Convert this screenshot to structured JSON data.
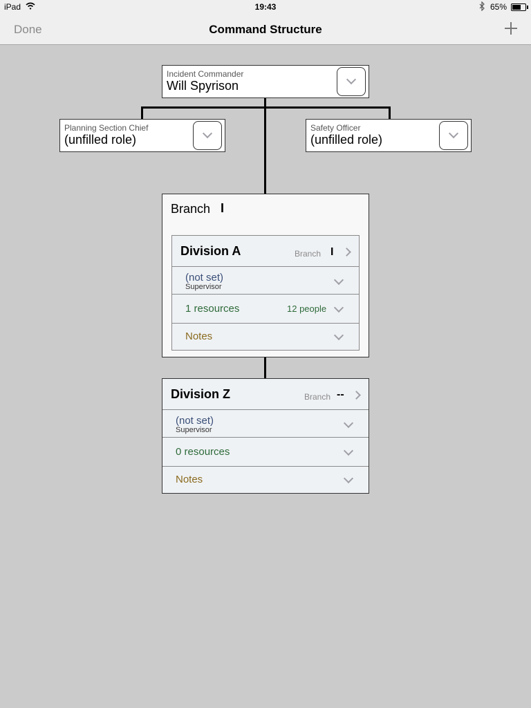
{
  "status_bar": {
    "device": "iPad",
    "time": "19:43",
    "battery": "65%"
  },
  "nav": {
    "done_label": "Done",
    "title": "Command Structure",
    "add_icon": "plus-icon"
  },
  "incident_commander": {
    "title": "Incident Commander",
    "name": "Will Spyrison"
  },
  "planning_chief": {
    "title": "Planning Section Chief",
    "name": "(unfilled role)"
  },
  "safety_officer": {
    "title": "Safety Officer",
    "name": "(unfilled role)"
  },
  "branch": {
    "label": "Branch",
    "number": "I"
  },
  "divisions": [
    {
      "name": "Division A",
      "branch_label": "Branch",
      "branch_value": "I",
      "supervisor_value": "(not set)",
      "supervisor_label": "Supervisor",
      "resources": "1 resources",
      "people": "12 people",
      "notes": "Notes"
    },
    {
      "name": "Division Z",
      "branch_label": "Branch",
      "branch_value": "--",
      "supervisor_value": "(not set)",
      "supervisor_label": "Supervisor",
      "resources": "0 resources",
      "people": "",
      "notes": "Notes"
    }
  ],
  "colors": {
    "background": "#cbcbcb",
    "bar": "#efefef",
    "supervisor_text": "#3a4f78",
    "resources_text": "#2e6b3a",
    "notes_text": "#8a6b1f"
  }
}
